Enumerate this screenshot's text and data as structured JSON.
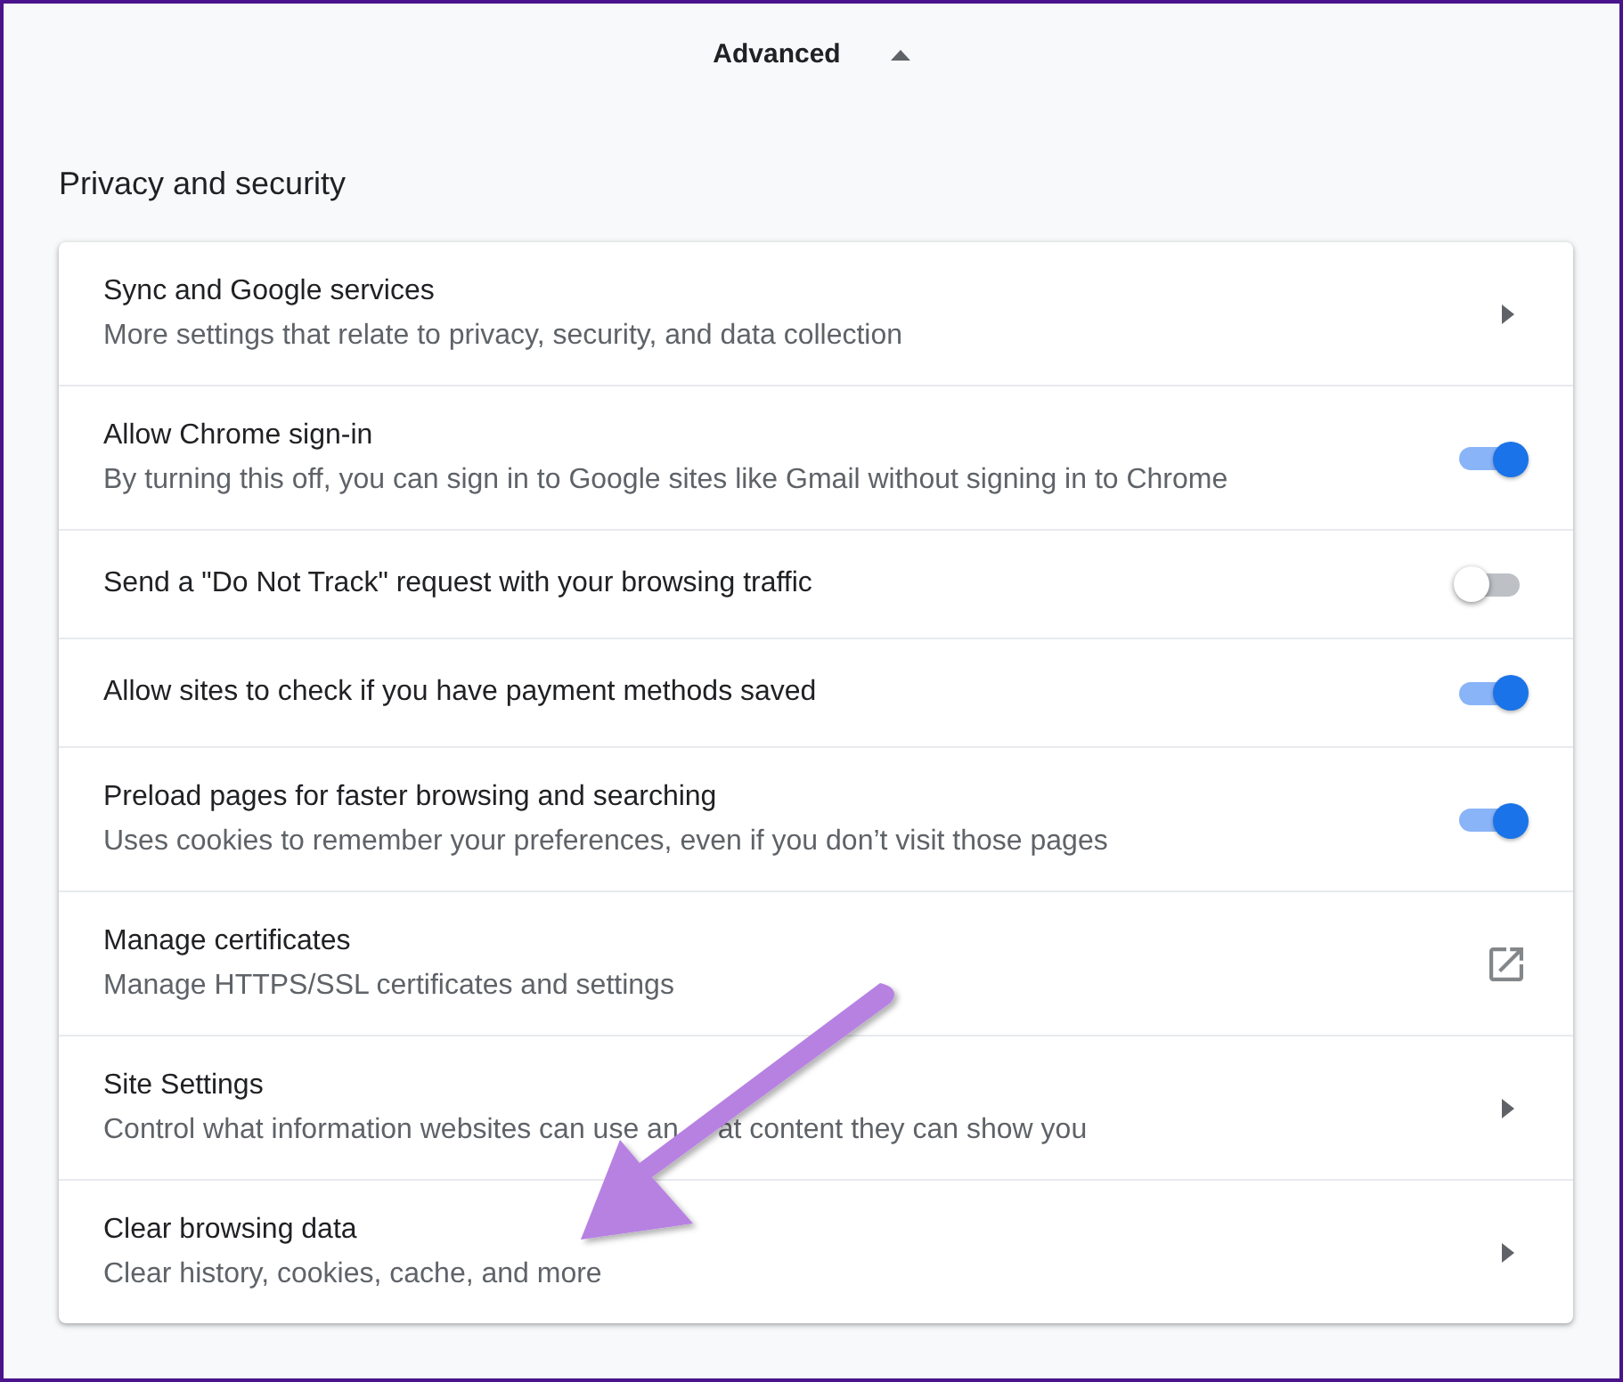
{
  "advanced": {
    "label": "Advanced",
    "expanded": true
  },
  "section": {
    "title": "Privacy and security"
  },
  "settings": [
    {
      "kind": "link",
      "title": "Sync and Google services",
      "description": "More settings that relate to privacy, security, and data collection"
    },
    {
      "kind": "toggle",
      "title": "Allow Chrome sign-in",
      "description": "By turning this off, you can sign in to Google sites like Gmail without signing in to Chrome",
      "on": true
    },
    {
      "kind": "toggle",
      "title": "Send a \"Do Not Track\" request with your browsing traffic",
      "on": false
    },
    {
      "kind": "toggle",
      "title": "Allow sites to check if you have payment methods saved",
      "on": true
    },
    {
      "kind": "toggle",
      "title": "Preload pages for faster browsing and searching",
      "description": "Uses cookies to remember your preferences, even if you don’t visit those pages",
      "on": true
    },
    {
      "kind": "external",
      "title": "Manage certificates",
      "description": "Manage HTTPS/SSL certificates and settings"
    },
    {
      "kind": "link",
      "title": "Site Settings",
      "description_parts": [
        "Control what information websites can use an",
        "at content they can show you"
      ]
    },
    {
      "kind": "link",
      "title": "Clear browsing data",
      "description": "Clear history, cookies, cache, and more"
    }
  ]
}
